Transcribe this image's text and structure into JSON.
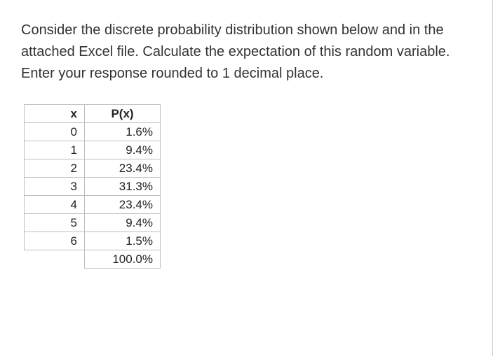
{
  "question": "Consider the discrete probability distribution shown below and in the attached Excel file.  Calculate the expectation of this random variable.   Enter your response rounded to 1 decimal place.",
  "table": {
    "headers": {
      "x": "x",
      "px": "P(x)"
    },
    "rows": [
      {
        "x": "0",
        "px": "1.6%"
      },
      {
        "x": "1",
        "px": "9.4%"
      },
      {
        "x": "2",
        "px": "23.4%"
      },
      {
        "x": "3",
        "px": "31.3%"
      },
      {
        "x": "4",
        "px": "23.4%"
      },
      {
        "x": "5",
        "px": "9.4%"
      },
      {
        "x": "6",
        "px": "1.5%"
      }
    ],
    "total": "100.0%"
  },
  "chart_data": {
    "type": "table",
    "title": "Discrete probability distribution",
    "columns": [
      "x",
      "P(x)"
    ],
    "rows": [
      [
        0,
        0.016
      ],
      [
        1,
        0.094
      ],
      [
        2,
        0.234
      ],
      [
        3,
        0.313
      ],
      [
        4,
        0.234
      ],
      [
        5,
        0.094
      ],
      [
        6,
        0.015
      ]
    ],
    "total": 1.0
  }
}
